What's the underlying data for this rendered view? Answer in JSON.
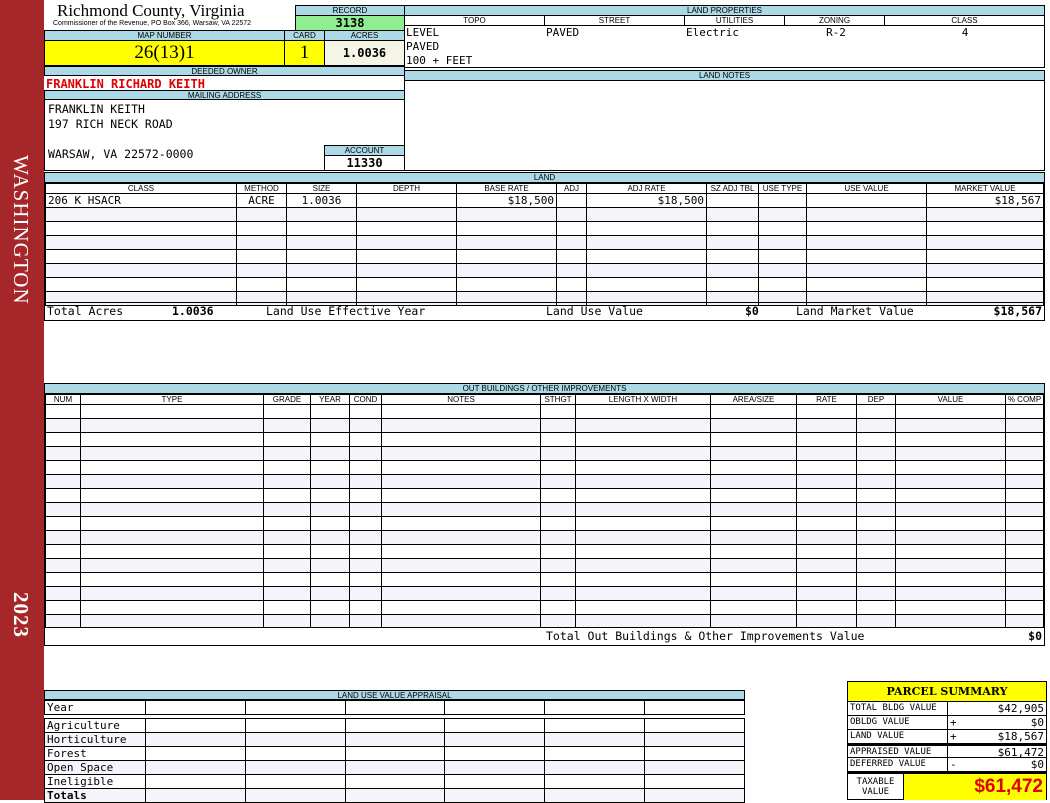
{
  "sidebar": {
    "district": "WASHINGTON",
    "year": "2023",
    "color": "#a5272a"
  },
  "header": {
    "county": "Richmond County, Virginia",
    "office": "Commissioner of the Revenue, PO Box 366, Warsaw, VA 22572"
  },
  "record": {
    "label": "RECORD",
    "value": "3138"
  },
  "map_number": {
    "label": "MAP NUMBER",
    "value": "26(13)1"
  },
  "card": {
    "label": "CARD",
    "value": "1"
  },
  "acres": {
    "label": "ACRES",
    "value": "1.0036"
  },
  "owner": {
    "label": "DEEDED OWNER",
    "value": "FRANKLIN RICHARD KEITH"
  },
  "mailing": {
    "label": "MAILING ADDRESS",
    "line1": "FRANKLIN KEITH",
    "line2": "197 RICH NECK ROAD",
    "line3": "WARSAW, VA 22572-0000"
  },
  "account": {
    "label": "ACCOUNT",
    "value": "11330"
  },
  "land_properties": {
    "label": "LAND PROPERTIES",
    "headers": [
      "TOPO",
      "STREET",
      "UTILITIES",
      "ZONING",
      "CLASS"
    ],
    "topo": [
      "LEVEL",
      "PAVED",
      "100 + FEET"
    ],
    "street": "PAVED",
    "utilities": "Electric",
    "zoning": "R-2",
    "class": "4"
  },
  "land_notes": {
    "label": "LAND NOTES"
  },
  "land": {
    "label": "LAND",
    "headers": [
      "CLASS",
      "METHOD",
      "SIZE",
      "DEPTH",
      "BASE RATE",
      "ADJ",
      "ADJ RATE",
      "SZ ADJ TBL",
      "USE TYPE",
      "USE VALUE",
      "MARKET VALUE"
    ],
    "rows": [
      [
        "206 K HSACR",
        "ACRE",
        "1.0036",
        "",
        "$18,500",
        "",
        "$18,500",
        "",
        "",
        "",
        "$18,567"
      ]
    ],
    "totals": {
      "total_acres_label": "Total Acres",
      "total_acres": "1.0036",
      "eff_year_label": "Land Use Effective Year",
      "use_value_label": "Land Use Value",
      "use_value": "$0",
      "market_label": "Land Market Value",
      "market_value": "$18,567"
    }
  },
  "outbuildings": {
    "label": "OUT BUILDINGS / OTHER IMPROVEMENTS",
    "headers": [
      "NUM",
      "TYPE",
      "GRADE",
      "YEAR",
      "COND",
      "NOTES",
      "STHGT",
      "LENGTH X WIDTH",
      "AREA/SIZE",
      "RATE",
      "DEP",
      "VALUE",
      "% COMP"
    ],
    "total_label": "Total Out Buildings & Other Improvements Value",
    "total_value": "$0"
  },
  "land_use": {
    "label": "LAND USE VALUE APPRAISAL",
    "year_label": "Year",
    "rows": [
      "Agriculture",
      "Horticulture",
      "Forest",
      "Open Space",
      "Ineligible"
    ],
    "totals_label": "Totals"
  },
  "parcel_summary": {
    "title": "PARCEL SUMMARY",
    "rows": [
      {
        "label": "TOTAL BLDG VALUE",
        "sign": "",
        "value": "$42,905"
      },
      {
        "label": "OBLDG VALUE",
        "sign": "+",
        "value": "$0"
      },
      {
        "label": "LAND VALUE",
        "sign": "+",
        "value": "$18,567"
      },
      {
        "label": "APPRAISED VALUE",
        "sign": "",
        "value": "$61,472"
      },
      {
        "label": "DEFERRED VALUE",
        "sign": "-",
        "value": "$0"
      }
    ],
    "taxable_label": "TAXABLE VALUE",
    "taxable_value": "$61,472"
  }
}
